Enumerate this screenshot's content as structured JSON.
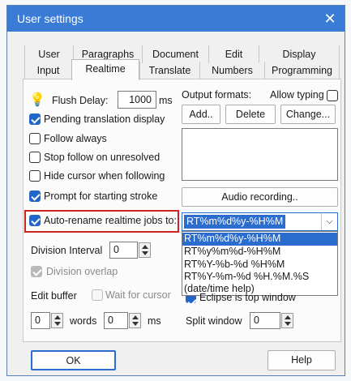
{
  "window": {
    "title": "User settings"
  },
  "tabs_row1": [
    "User",
    "Paragraphs",
    "Document",
    "Edit",
    "Display"
  ],
  "tabs_row2": [
    "Input",
    "Realtime",
    "Translate",
    "Numbers",
    "Programming"
  ],
  "active_tab": "Realtime",
  "left": {
    "flush_delay_label": "Flush Delay:",
    "flush_delay_value": "1000",
    "flush_delay_unit": "ms",
    "pending_translation": "Pending translation display",
    "follow_always": "Follow always",
    "stop_follow": "Stop follow on unresolved",
    "hide_cursor": "Hide cursor when following",
    "prompt_stroke": "Prompt for starting stroke",
    "auto_rename": "Auto-rename realtime jobs to:",
    "division_interval_label": "Division Interval",
    "division_interval_value": "0",
    "division_overlap": "Division overlap",
    "edit_buffer_label": "Edit buffer",
    "wait_for_cursor": "Wait for cursor",
    "words_value": "0",
    "words_label": "words",
    "ms_value": "0",
    "ms_label": "ms"
  },
  "right": {
    "output_formats_label": "Output formats:",
    "allow_typing": "Allow typing",
    "add_button": "Add..",
    "delete_button": "Delete",
    "change_button": "Change...",
    "audio_recording_button": "Audio recording..",
    "eclipse_top": "Eclipse is top window",
    "split_window_label": "Split window",
    "split_window_value": "0"
  },
  "combo": {
    "value": "RT%m%d%y-%H%M",
    "options": [
      "RT%m%d%y-%H%M",
      "RT%y%m%d-%H%M",
      "RT%Y-%b-%d %H%M",
      "RT%Y-%m-%d %H.%M.%S",
      "(date/time help)"
    ]
  },
  "footer": {
    "ok": "OK",
    "help": "Help"
  },
  "colors": {
    "titlebar": "#3a7bd5",
    "check": "#2267c7",
    "highlight": "#cc2222",
    "selection": "#2b6ccf"
  }
}
